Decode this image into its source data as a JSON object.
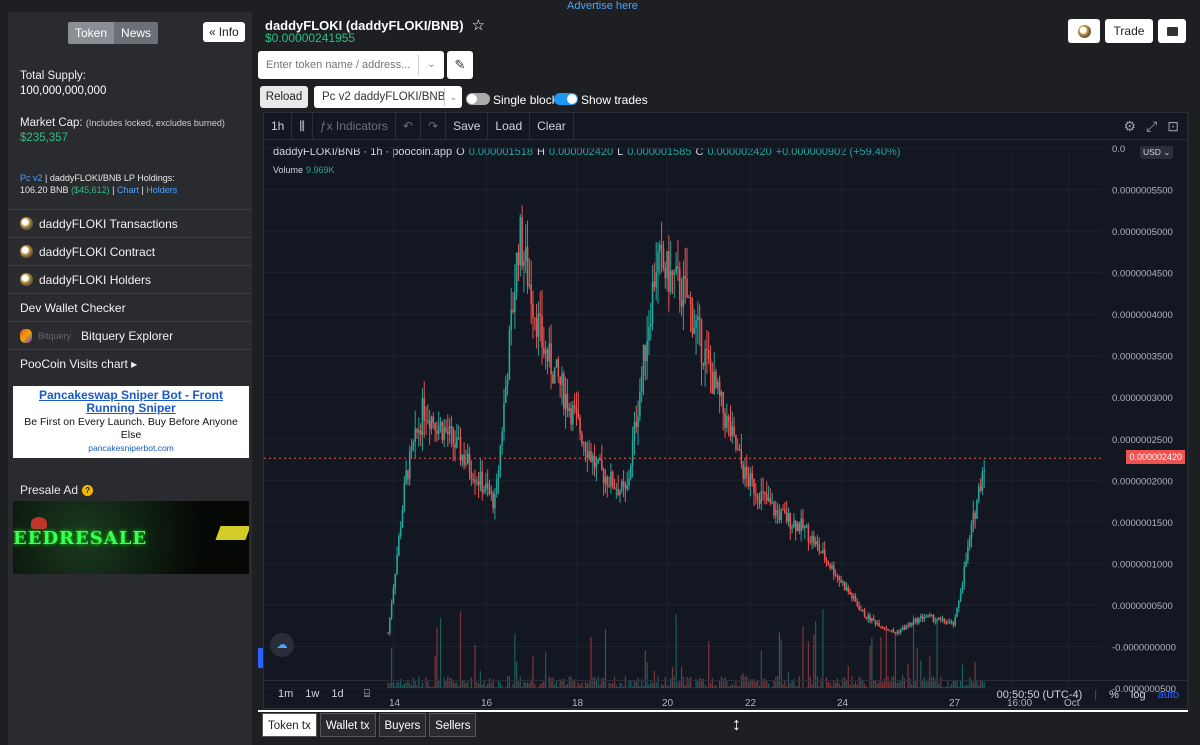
{
  "advert": "Advertise here",
  "sidebar": {
    "tabs": [
      "Token",
      "News"
    ],
    "info_label": "Info",
    "total_supply_label": "Total Supply:",
    "total_supply_value": "100,000,000,000",
    "market_cap_label": "Market Cap:",
    "market_cap_note": "(Includes locked, excludes burned)",
    "market_cap_value": "$235,357",
    "lp_version": "Pc v2",
    "lp_title": " | daddyFLOKI/BNB LP Holdings:",
    "lp_bnb": "106.20 BNB",
    "lp_usd": "($45,612)",
    "lp_sep1": " | ",
    "lp_chart": "Chart",
    "lp_sep2": " | ",
    "lp_holders": "Holders",
    "menu": [
      {
        "label": "daddyFLOKI Transactions",
        "icon": "poocoin-icon"
      },
      {
        "label": "daddyFLOKI Contract",
        "icon": "poocoin-icon"
      },
      {
        "label": "daddyFLOKI Holders",
        "icon": "poocoin-icon"
      },
      {
        "label": "Dev Wallet Checker",
        "icon": ""
      },
      {
        "label": "Bitquery Explorer",
        "icon": "bitquery-icon"
      },
      {
        "label": "PooCoin Visits chart ▸",
        "icon": ""
      }
    ],
    "ad": {
      "title": "Pancakeswap Sniper Bot - Front Running Sniper",
      "desc": "Be First on Every Launch. Buy Before Anyone Else",
      "url": "pancakesniperbot.com"
    },
    "presale_label": "Presale Ad",
    "banner_text": "EEDRESALE"
  },
  "header": {
    "title": "daddyFLOKI (daddyFLOKI/BNB)",
    "price": "$0.00000241955",
    "trade_label": "Trade",
    "search_placeholder": "Enter token name / address...",
    "reload_label": "Reload",
    "pair_select": "Pc v2 daddyFLOKI/BNB",
    "single_blocks_label": "Single blocks",
    "show_trades_label": "Show trades",
    "single_blocks_on": false,
    "show_trades_on": true
  },
  "chart_toolbar": {
    "interval": "1h",
    "indicators": "Indicators",
    "save": "Save",
    "load": "Load",
    "clear": "Clear"
  },
  "chart_legend": {
    "symbol": "daddyFLOKI/BNB · 1h · poocoin.app",
    "o_label": "O",
    "o": "0.000001518",
    "h_label": "H",
    "h": "0.000002420",
    "l_label": "L",
    "l": "0.000001585",
    "c_label": "C",
    "c": "0.000002420",
    "change": "+0.000000902 (+59.40%)",
    "volume_label": "Volume",
    "volume": "9.969K",
    "currency": "USD"
  },
  "chart_data": {
    "type": "candlestick",
    "pair": "daddyFLOKI/BNB",
    "interval": "1h",
    "last_price": 2.42e-06,
    "last_price_label": "0.000002420",
    "y_ticks": [
      "0.0",
      "0.0000005500",
      "0.0000005000",
      "0.0000004500",
      "0.0000004000",
      "0.0000003500",
      "0.0000003000",
      "0.0000002500",
      "0.0000002000",
      "0.0000001500",
      "0.0000001000",
      "0.0000000500",
      "-0.0000000000",
      "-0.0000000500"
    ],
    "x_ticks": [
      "14",
      "16",
      "18",
      "20",
      "22",
      "24",
      "27",
      "16:00",
      "Oct"
    ],
    "trace_x": [
      0,
      3,
      6,
      10,
      14,
      18,
      22,
      26,
      30,
      35,
      40,
      45,
      50,
      55,
      60,
      65,
      70,
      75,
      80,
      85,
      90,
      95,
      100
    ],
    "trace_close": [
      4e-07,
      2.2e-06,
      3e-06,
      2.7e-06,
      2.3e-06,
      1.9e-06,
      5e-06,
      3.7e-06,
      3.1e-06,
      2.3e-06,
      2e-06,
      4.7e-06,
      4.3e-06,
      3.2e-06,
      2.2e-06,
      1.8e-06,
      1.6e-06,
      1.1e-06,
      6e-07,
      4e-07,
      6e-07,
      5e-07,
      2.4e-06
    ],
    "colors": {
      "up": "#26a69a",
      "down": "#ef5350"
    }
  },
  "bottom_toolbar": {
    "ranges": [
      "1m",
      "1w",
      "1d"
    ],
    "clock": "00:50:50 (UTC-4)",
    "pct": "%",
    "log": "log",
    "auto": "auto"
  },
  "bottom_tabs": [
    "Token tx",
    "Wallet tx",
    "Buyers",
    "Sellers"
  ]
}
